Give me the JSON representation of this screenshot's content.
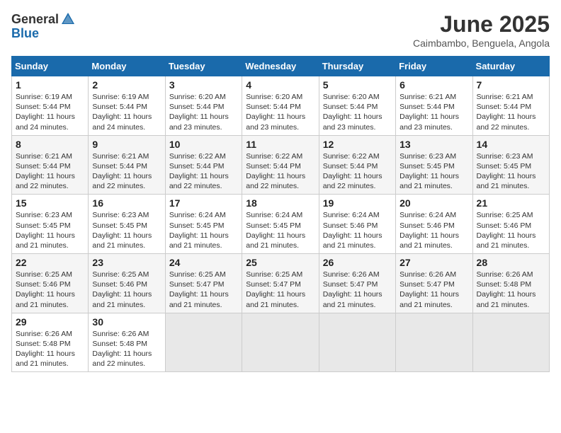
{
  "header": {
    "logo_general": "General",
    "logo_blue": "Blue",
    "month": "June 2025",
    "location": "Caimbambo, Benguela, Angola"
  },
  "weekdays": [
    "Sunday",
    "Monday",
    "Tuesday",
    "Wednesday",
    "Thursday",
    "Friday",
    "Saturday"
  ],
  "weeks": [
    [
      {
        "day": "1",
        "text": "Sunrise: 6:19 AM\nSunset: 5:44 PM\nDaylight: 11 hours\nand 24 minutes."
      },
      {
        "day": "2",
        "text": "Sunrise: 6:19 AM\nSunset: 5:44 PM\nDaylight: 11 hours\nand 24 minutes."
      },
      {
        "day": "3",
        "text": "Sunrise: 6:20 AM\nSunset: 5:44 PM\nDaylight: 11 hours\nand 23 minutes."
      },
      {
        "day": "4",
        "text": "Sunrise: 6:20 AM\nSunset: 5:44 PM\nDaylight: 11 hours\nand 23 minutes."
      },
      {
        "day": "5",
        "text": "Sunrise: 6:20 AM\nSunset: 5:44 PM\nDaylight: 11 hours\nand 23 minutes."
      },
      {
        "day": "6",
        "text": "Sunrise: 6:21 AM\nSunset: 5:44 PM\nDaylight: 11 hours\nand 23 minutes."
      },
      {
        "day": "7",
        "text": "Sunrise: 6:21 AM\nSunset: 5:44 PM\nDaylight: 11 hours\nand 22 minutes."
      }
    ],
    [
      {
        "day": "8",
        "text": "Sunrise: 6:21 AM\nSunset: 5:44 PM\nDaylight: 11 hours\nand 22 minutes."
      },
      {
        "day": "9",
        "text": "Sunrise: 6:21 AM\nSunset: 5:44 PM\nDaylight: 11 hours\nand 22 minutes."
      },
      {
        "day": "10",
        "text": "Sunrise: 6:22 AM\nSunset: 5:44 PM\nDaylight: 11 hours\nand 22 minutes."
      },
      {
        "day": "11",
        "text": "Sunrise: 6:22 AM\nSunset: 5:44 PM\nDaylight: 11 hours\nand 22 minutes."
      },
      {
        "day": "12",
        "text": "Sunrise: 6:22 AM\nSunset: 5:44 PM\nDaylight: 11 hours\nand 22 minutes."
      },
      {
        "day": "13",
        "text": "Sunrise: 6:23 AM\nSunset: 5:45 PM\nDaylight: 11 hours\nand 21 minutes."
      },
      {
        "day": "14",
        "text": "Sunrise: 6:23 AM\nSunset: 5:45 PM\nDaylight: 11 hours\nand 21 minutes."
      }
    ],
    [
      {
        "day": "15",
        "text": "Sunrise: 6:23 AM\nSunset: 5:45 PM\nDaylight: 11 hours\nand 21 minutes."
      },
      {
        "day": "16",
        "text": "Sunrise: 6:23 AM\nSunset: 5:45 PM\nDaylight: 11 hours\nand 21 minutes."
      },
      {
        "day": "17",
        "text": "Sunrise: 6:24 AM\nSunset: 5:45 PM\nDaylight: 11 hours\nand 21 minutes."
      },
      {
        "day": "18",
        "text": "Sunrise: 6:24 AM\nSunset: 5:45 PM\nDaylight: 11 hours\nand 21 minutes."
      },
      {
        "day": "19",
        "text": "Sunrise: 6:24 AM\nSunset: 5:46 PM\nDaylight: 11 hours\nand 21 minutes."
      },
      {
        "day": "20",
        "text": "Sunrise: 6:24 AM\nSunset: 5:46 PM\nDaylight: 11 hours\nand 21 minutes."
      },
      {
        "day": "21",
        "text": "Sunrise: 6:25 AM\nSunset: 5:46 PM\nDaylight: 11 hours\nand 21 minutes."
      }
    ],
    [
      {
        "day": "22",
        "text": "Sunrise: 6:25 AM\nSunset: 5:46 PM\nDaylight: 11 hours\nand 21 minutes."
      },
      {
        "day": "23",
        "text": "Sunrise: 6:25 AM\nSunset: 5:46 PM\nDaylight: 11 hours\nand 21 minutes."
      },
      {
        "day": "24",
        "text": "Sunrise: 6:25 AM\nSunset: 5:47 PM\nDaylight: 11 hours\nand 21 minutes."
      },
      {
        "day": "25",
        "text": "Sunrise: 6:25 AM\nSunset: 5:47 PM\nDaylight: 11 hours\nand 21 minutes."
      },
      {
        "day": "26",
        "text": "Sunrise: 6:26 AM\nSunset: 5:47 PM\nDaylight: 11 hours\nand 21 minutes."
      },
      {
        "day": "27",
        "text": "Sunrise: 6:26 AM\nSunset: 5:47 PM\nDaylight: 11 hours\nand 21 minutes."
      },
      {
        "day": "28",
        "text": "Sunrise: 6:26 AM\nSunset: 5:48 PM\nDaylight: 11 hours\nand 21 minutes."
      }
    ],
    [
      {
        "day": "29",
        "text": "Sunrise: 6:26 AM\nSunset: 5:48 PM\nDaylight: 11 hours\nand 21 minutes."
      },
      {
        "day": "30",
        "text": "Sunrise: 6:26 AM\nSunset: 5:48 PM\nDaylight: 11 hours\nand 22 minutes."
      },
      {
        "day": "",
        "text": ""
      },
      {
        "day": "",
        "text": ""
      },
      {
        "day": "",
        "text": ""
      },
      {
        "day": "",
        "text": ""
      },
      {
        "day": "",
        "text": ""
      }
    ]
  ]
}
